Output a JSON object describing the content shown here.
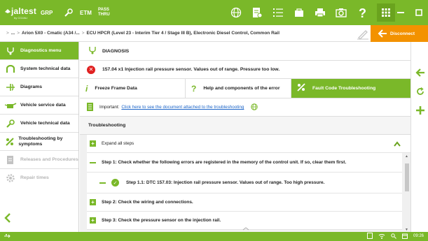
{
  "topbar": {
    "logo_text": "jaltest",
    "logo_sub": "by COJALI",
    "product_grp": "GRP",
    "product_etm": "ETM",
    "pass_line1": "PASS",
    "pass_line2": "THRU"
  },
  "breadcrumb": {
    "items": [
      ">",
      "...",
      ">",
      "Arion 5X0 - Cmatic (A34 /...",
      ">",
      "ECU HPCR (Level 23 - Interim Tier 4 / Stage III B), Electronic Diesel Control, Common Rail"
    ],
    "disconnect_label": "Disconnect"
  },
  "sidebar": {
    "items": [
      {
        "label": "Diagnostics menu"
      },
      {
        "label": "System technical data"
      },
      {
        "label": "Diagrams"
      },
      {
        "label": "Vehicle service data"
      },
      {
        "label": "Vehicle technical data"
      },
      {
        "label": "Troubleshooting by symptoms"
      },
      {
        "label": "Releases and Procedures"
      },
      {
        "label": "Repair times"
      }
    ]
  },
  "main": {
    "header_title": "DIAGNOSIS",
    "error_text": "157.04  x1  Injection rail pressure sensor. Values out of range. Pressure too low.",
    "tabs": [
      {
        "label": "Freeze Frame Data"
      },
      {
        "label": "Help and components of the error"
      },
      {
        "label": "Fault Code Troubleshooting"
      }
    ],
    "doc_prefix": "Important:",
    "doc_link": "Click here to see the document attached to the troubleshooting",
    "troubleshooting_title": "Troubleshooting",
    "expand_label": "Expand all steps",
    "steps": [
      {
        "label": "Step 1: Check whether the following errors are registered in the memory of the control unit. If so, clear them first."
      },
      {
        "label": "Step 1.1: DTC 157.03: Injection rail pressure sensor. Values out of range. Too high pressure."
      },
      {
        "label": "Step 2: Check the wiring and connections."
      },
      {
        "label": "Step 3: Check the pressure sensor on the injection rail."
      }
    ]
  },
  "statusbar": {
    "time": "09:26"
  },
  "colors": {
    "brand_green": "#7ab829",
    "accent_orange": "#f39200",
    "error_red": "#e02020",
    "link_blue": "#1b64c8"
  }
}
